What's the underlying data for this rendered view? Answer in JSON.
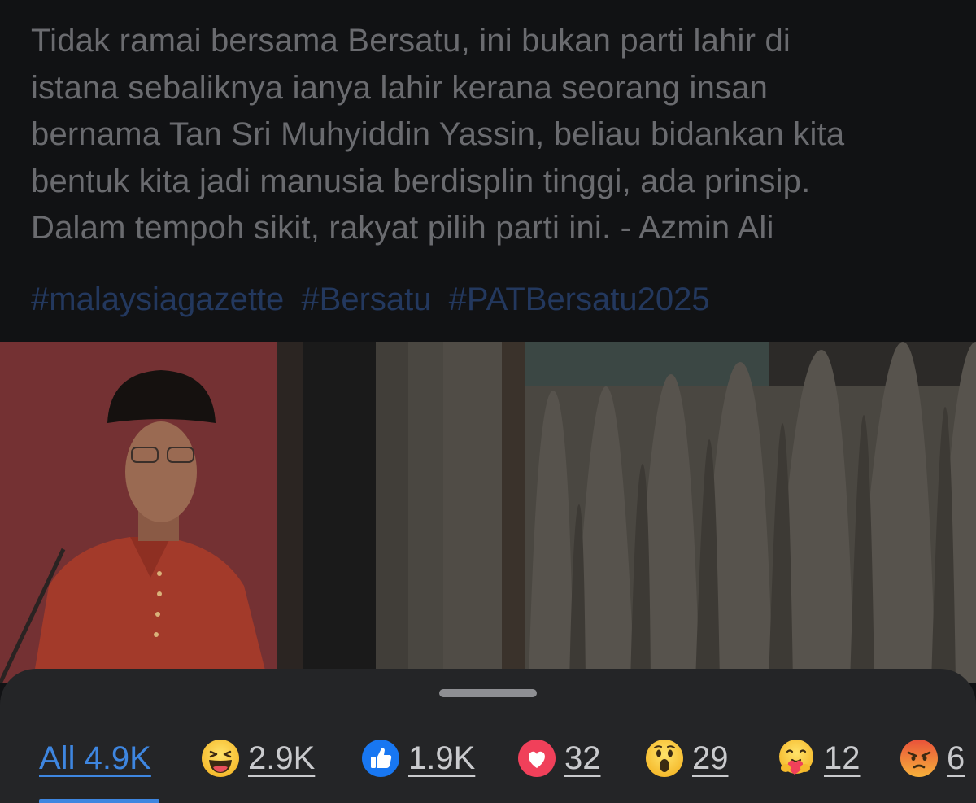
{
  "post": {
    "text_lines": [
      "Tidak ramai bersama Bersatu, ini bukan parti lahir di",
      "istana sebaliknya ianya lahir kerana seorang insan",
      "bernama Tan Sri Muhyiddin Yassin, beliau bidankan kita",
      "bentuk kita jadi manusia berdisplin tinggi, ada prinsip.",
      "Dalam tempoh sikit, rakyat pilih parti ini.  - Azmin Ali"
    ],
    "hashtags": [
      "#malaysiagazette",
      "#Bersatu",
      "#PATBersatu2025"
    ]
  },
  "reactions_sheet": {
    "tabs": [
      {
        "id": "all",
        "label": "All 4.9K",
        "icon": "",
        "selected": true
      },
      {
        "id": "haha",
        "label": "2.9K",
        "icon": "haha-emoji-icon",
        "selected": false
      },
      {
        "id": "like",
        "label": "1.9K",
        "icon": "like-thumb-icon",
        "selected": false
      },
      {
        "id": "love",
        "label": "32",
        "icon": "heart-icon",
        "selected": false
      },
      {
        "id": "wow",
        "label": "29",
        "icon": "wow-emoji-icon",
        "selected": false
      },
      {
        "id": "care",
        "label": "12",
        "icon": "care-emoji-icon",
        "selected": false
      },
      {
        "id": "angry",
        "label": "6",
        "icon": "angry-emoji-icon",
        "selected": false
      }
    ]
  },
  "colors": {
    "background": "#111214",
    "sheet": "#242527",
    "accent": "#3e86e0",
    "dim_text": "#6a6b6f",
    "hashtag": "#23385e"
  }
}
